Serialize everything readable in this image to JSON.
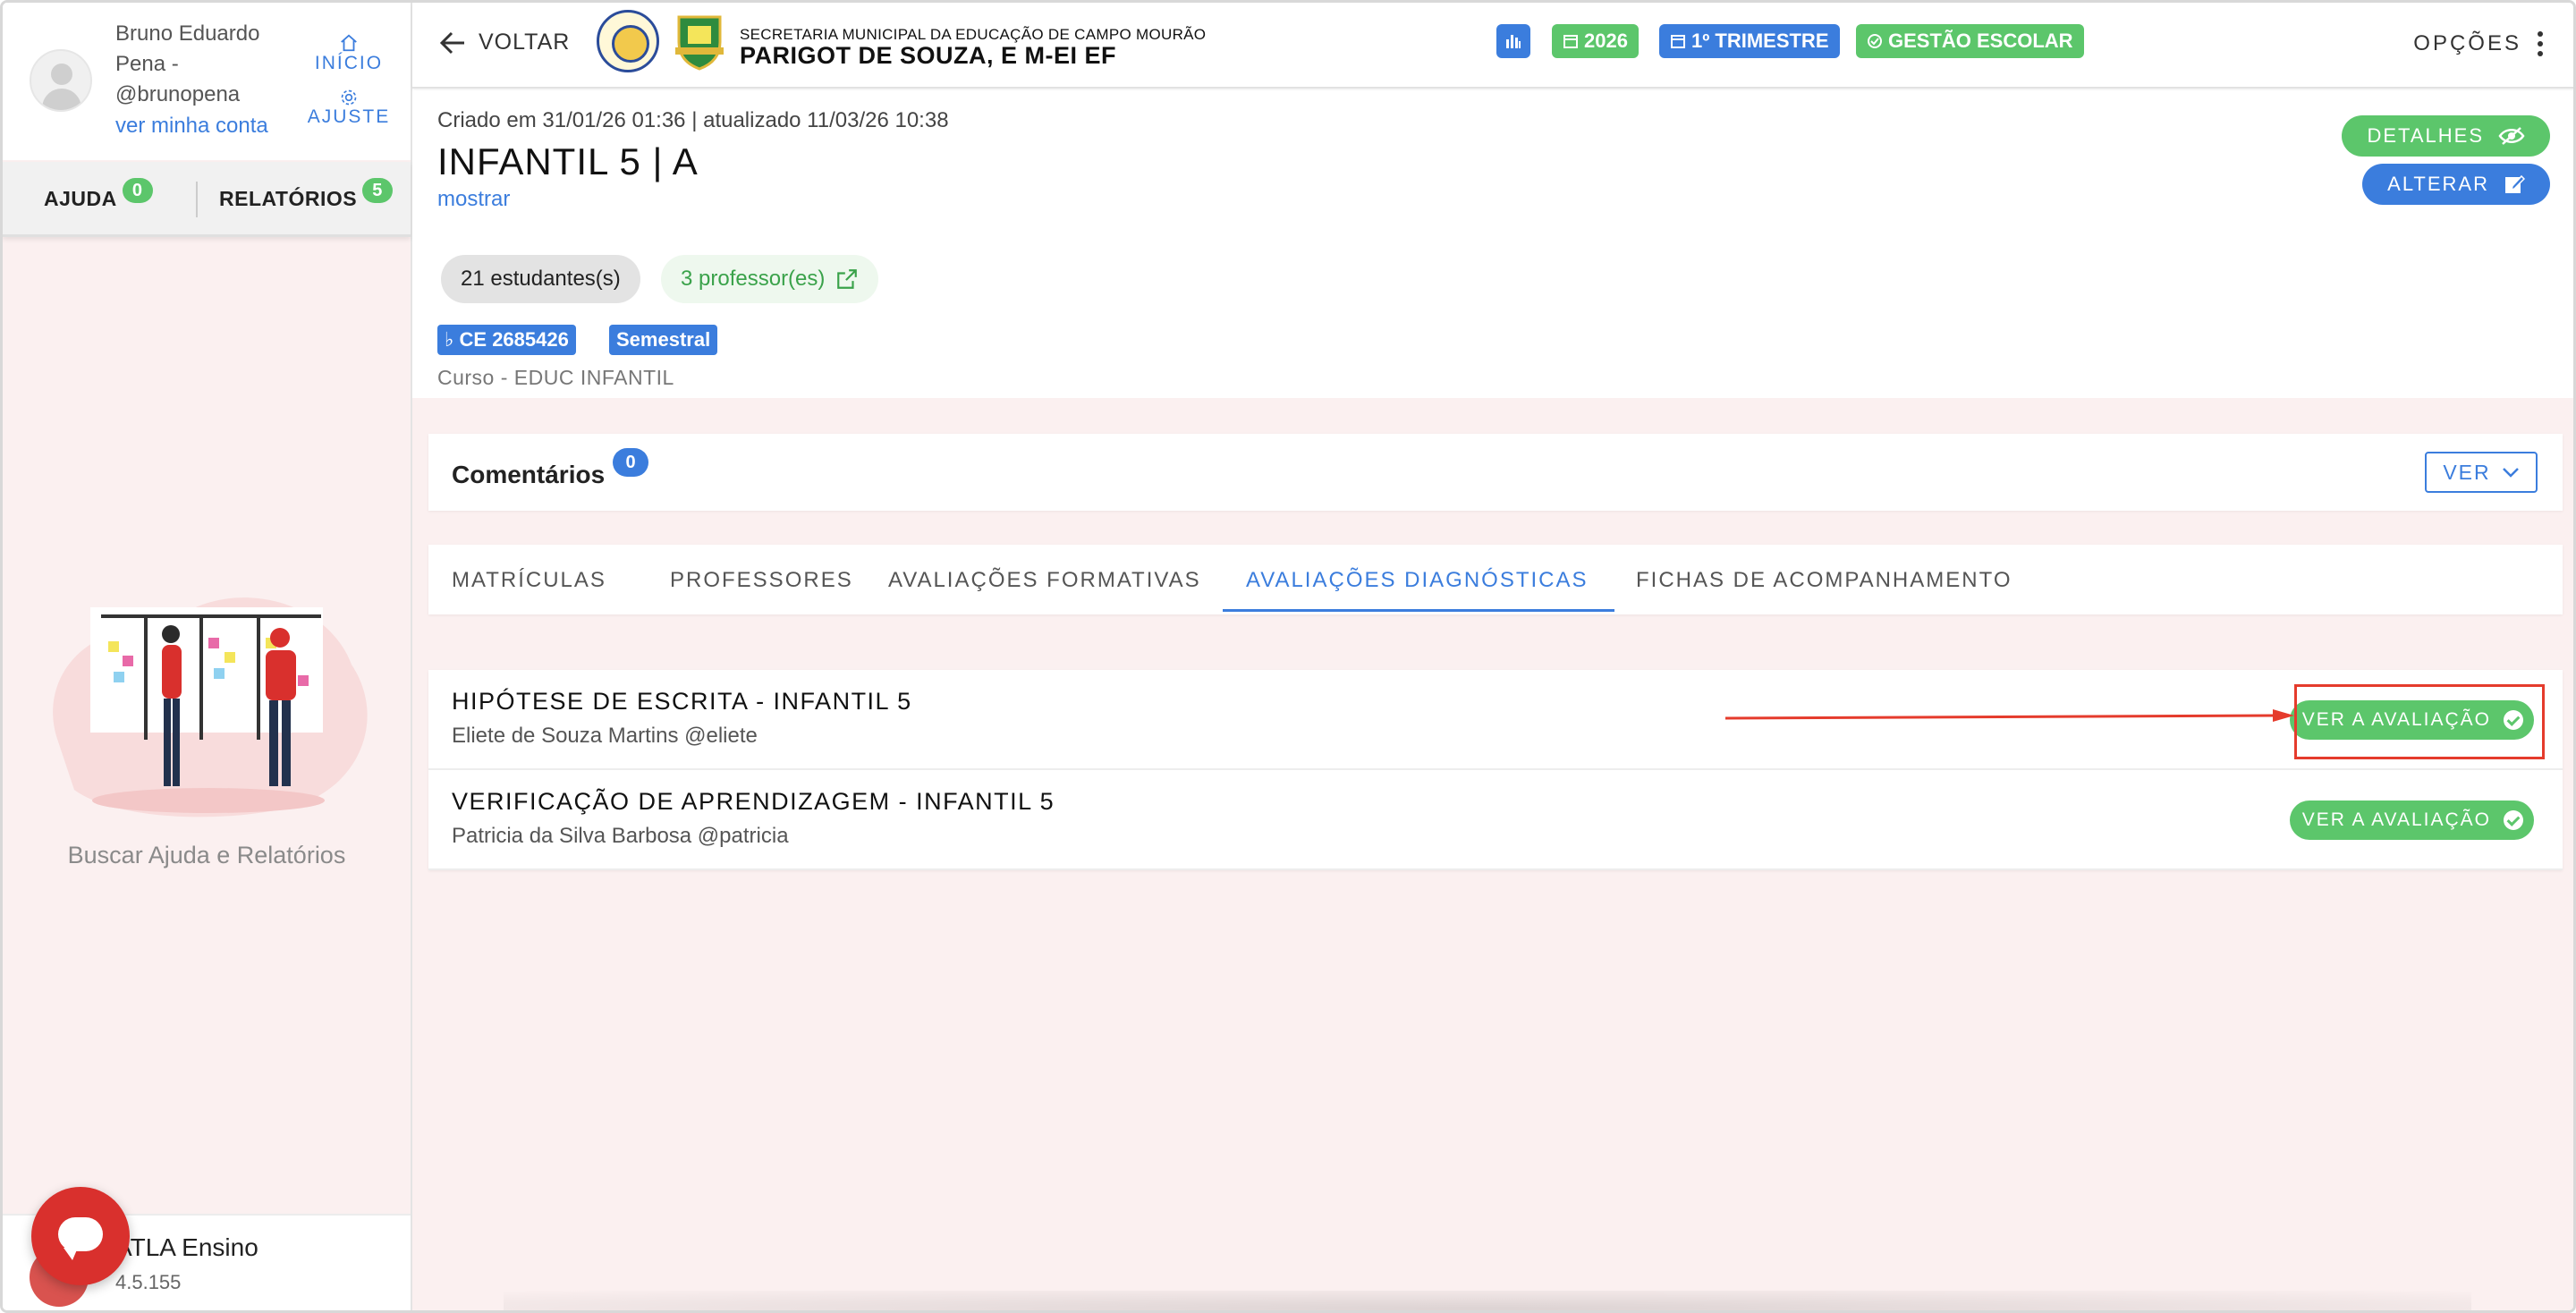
{
  "user": {
    "name_line1": "Bruno Eduardo",
    "name_line2": "Pena -",
    "name_line3": "@brunopena",
    "account_link": "ver minha conta"
  },
  "quick_links": {
    "home": "INÍCIO",
    "settings": "AJUSTE"
  },
  "side_tabs": [
    {
      "label": "AJUDA",
      "count": "0"
    },
    {
      "label": "RELATÓRIOS",
      "count": "5"
    }
  ],
  "side_search": "Buscar Ajuda e Relatórios",
  "footer": {
    "app_name": "ATLA Ensino",
    "version": "4.5.155"
  },
  "header": {
    "back": "VOLTAR",
    "org_sub": "SECRETARIA MUNICIPAL DA EDUCAÇÃO DE CAMPO MOURÃO",
    "org_name": "PARIGOT DE SOUZA, E M-EI EF",
    "chips": {
      "year": "2026",
      "term": "1º TRIMESTRE",
      "mgmt": "GESTÃO ESCOLAR"
    },
    "options": "OPÇÕES"
  },
  "class": {
    "meta": "Criado em 31/01/26 01:36 | atualizado 11/03/26 10:38",
    "title": "INFANTIL 5 | A",
    "show": "mostrar",
    "students": "21 estudantes(s)",
    "teachers": "3 professor(es)",
    "code": "CE 2685426",
    "period": "Semestral",
    "course": "Curso - EDUC INFANTIL",
    "details_btn": "DETALHES",
    "edit_btn": "ALTERAR"
  },
  "comments": {
    "title": "Comentários",
    "count": "0",
    "ver": "VER"
  },
  "tabs": [
    {
      "label": "MATRÍCULAS",
      "active": false
    },
    {
      "label": "PROFESSORES",
      "active": false
    },
    {
      "label": "AVALIAÇÕES FORMATIVAS",
      "active": false
    },
    {
      "label": "AVALIAÇÕES DIAGNÓSTICAS",
      "active": true
    },
    {
      "label": "FICHAS DE ACOMPANHAMENTO",
      "active": false
    }
  ],
  "evaluations": [
    {
      "title": "HIPÓTESE DE ESCRITA - INFANTIL 5",
      "author": "Eliete de Souza Martins @eliete",
      "button": "VER A AVALIAÇÃO"
    },
    {
      "title": "VERIFICAÇÃO DE APRENDIZAGEM - INFANTIL 5",
      "author": "Patricia da Silva Barbosa @patricia",
      "button": "VER A AVALIAÇÃO"
    }
  ],
  "colors": {
    "accent_blue": "#3b7ddd",
    "accent_green": "#5cc66b",
    "annotation_red": "#e53b2c"
  }
}
